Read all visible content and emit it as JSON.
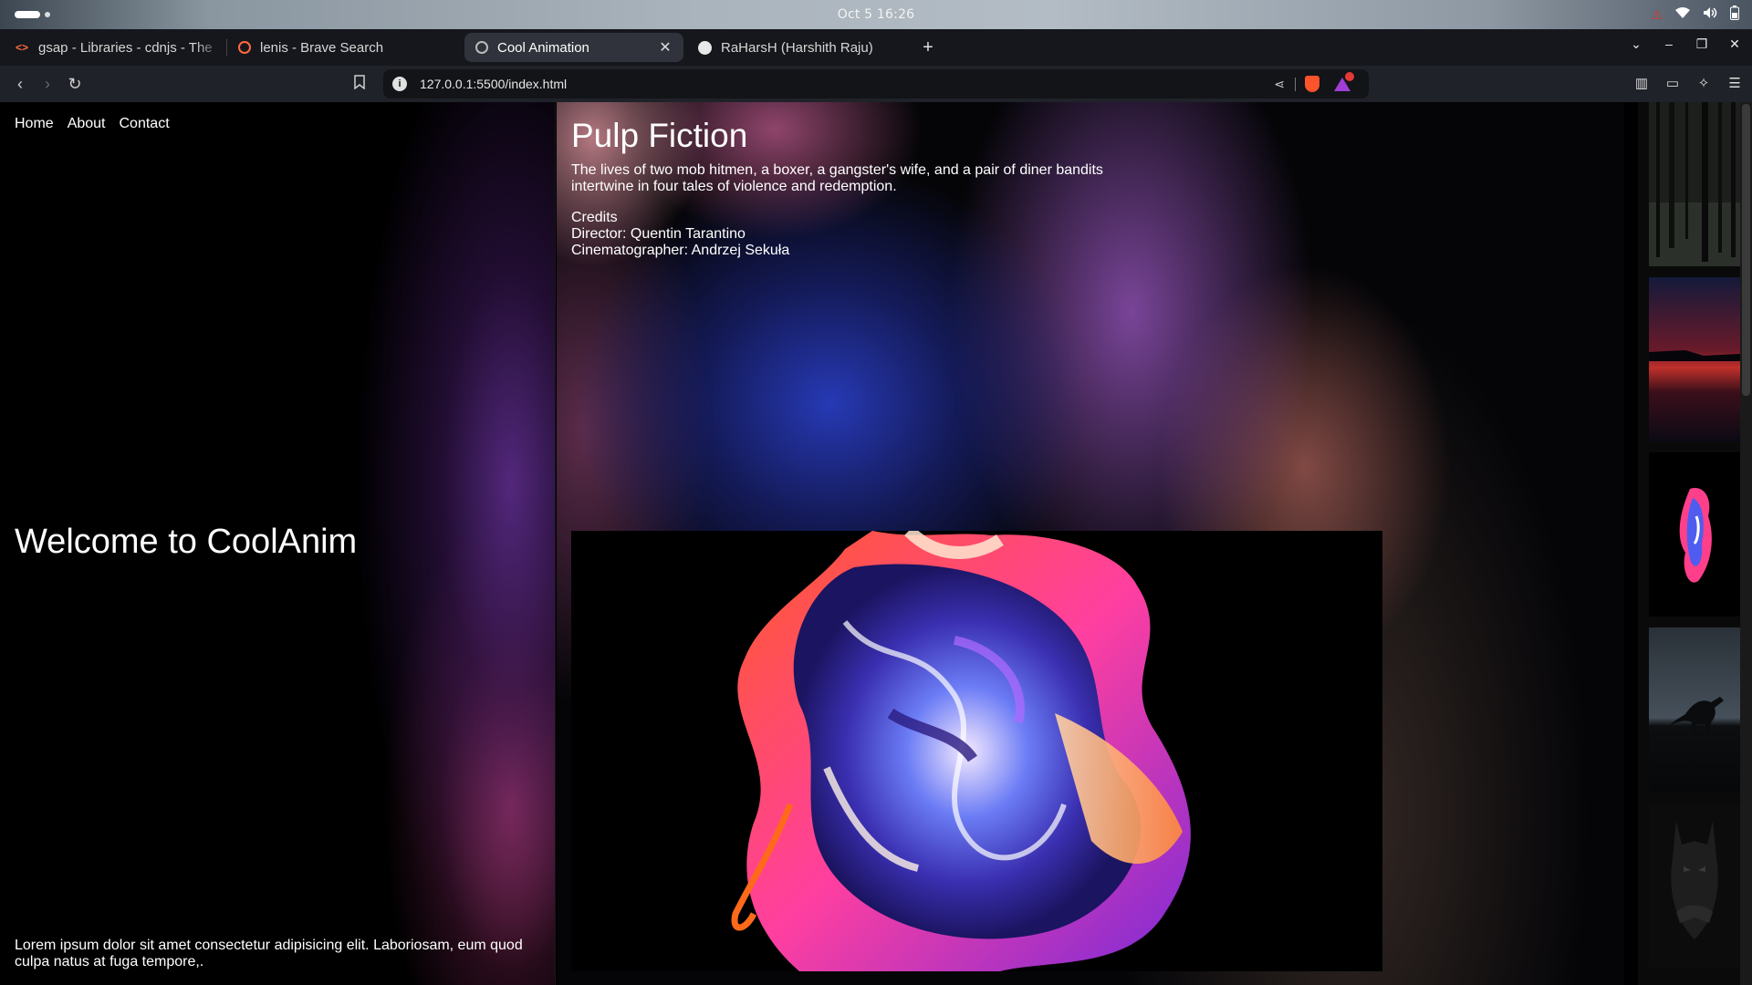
{
  "os": {
    "clock": "Oct 5  16:26",
    "icons": [
      "warning-icon",
      "wifi-icon",
      "volume-icon",
      "battery-icon"
    ]
  },
  "browser": {
    "tabs": [
      {
        "title": "gsap - Libraries - cdnjs - The #1 free and open source CDN",
        "favicon": "code-icon",
        "active": false
      },
      {
        "title": "lenis - Brave Search",
        "favicon": "brave-search-icon",
        "active": false
      },
      {
        "title": "Cool Animation",
        "favicon": "globe-icon",
        "active": true
      },
      {
        "title": "RaHarsH (Harshith Raju)",
        "favicon": "github-icon",
        "active": false
      }
    ],
    "new_tab_label": "+",
    "url": "127.0.0.1:5500/index.html",
    "rewards_badge_color": "#e53935"
  },
  "page": {
    "nav": [
      "Home",
      "About",
      "Contact"
    ],
    "welcome": "Welcome to CoolAnim",
    "lorem": "Lorem ipsum dolor sit amet consectetur adipisicing elit. Laboriosam, eum quod culpa natus at fuga tempore,.",
    "movie": {
      "title": "Pulp Fiction",
      "description": "The lives of two mob hitmen, a boxer, a gangster's wife, and a pair of diner bandits intertwine in four tales of violence and redemption.",
      "credits_heading": "Credits",
      "director": "Director: Quentin Tarantino",
      "cinematographer": "Cinematographer: Andrzej Sekuła"
    },
    "thumbnails": [
      "dark-forest-thumbnail",
      "red-sunset-lake-thumbnail",
      "abstract-paint-thumbnail",
      "dinosaur-silhouette-thumbnail",
      "batman-dark-thumbnail"
    ]
  }
}
